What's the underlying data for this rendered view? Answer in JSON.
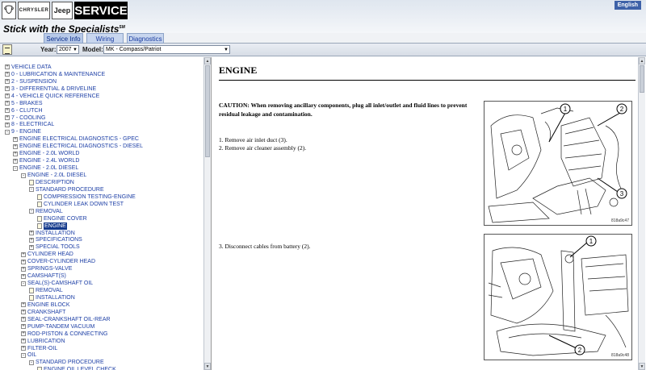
{
  "header": {
    "logo_ram": "RAM",
    "logo_chrysler": "CHRYSLER",
    "logo_jeep": "Jeep",
    "service": "SERVICE",
    "language": "English",
    "tagline": "Stick with the Specialists",
    "tagline_mark": "SM"
  },
  "tabs": [
    {
      "label": "Service Info"
    },
    {
      "label": "Wiring"
    },
    {
      "label": "Diagnostics"
    }
  ],
  "selectors": {
    "year_label": "Year:",
    "year_value": "2007",
    "model_label": "Model:",
    "model_value": "MK - Compass/Patriot"
  },
  "tree": [
    {
      "label": "VEHICLE DATA",
      "indent": 0,
      "kind": "exp",
      "sym": "+"
    },
    {
      "label": "0 - LUBRICATION & MAINTENANCE",
      "indent": 0,
      "kind": "exp",
      "sym": "+"
    },
    {
      "label": "2 - SUSPENSION",
      "indent": 0,
      "kind": "exp",
      "sym": "+"
    },
    {
      "label": "3 - DIFFERENTIAL & DRIVELINE",
      "indent": 0,
      "kind": "exp",
      "sym": "+"
    },
    {
      "label": "4 - VEHICLE QUICK REFERENCE",
      "indent": 0,
      "kind": "exp",
      "sym": "+"
    },
    {
      "label": "5 - BRAKES",
      "indent": 0,
      "kind": "exp",
      "sym": "+"
    },
    {
      "label": "6 - CLUTCH",
      "indent": 0,
      "kind": "exp",
      "sym": "+"
    },
    {
      "label": "7 - COOLING",
      "indent": 0,
      "kind": "exp",
      "sym": "+"
    },
    {
      "label": "8 - ELECTRICAL",
      "indent": 0,
      "kind": "exp",
      "sym": "+"
    },
    {
      "label": "9 - ENGINE",
      "indent": 0,
      "kind": "exp",
      "sym": "-"
    },
    {
      "label": "ENGINE ELECTRICAL DIAGNOSTICS - GPEC",
      "indent": 1,
      "kind": "exp",
      "sym": "+"
    },
    {
      "label": "ENGINE ELECTRICAL DIAGNOSTICS - DIESEL",
      "indent": 1,
      "kind": "exp",
      "sym": "+"
    },
    {
      "label": "ENGINE - 2.0L WORLD",
      "indent": 1,
      "kind": "exp",
      "sym": "+"
    },
    {
      "label": "ENGINE - 2.4L WORLD",
      "indent": 1,
      "kind": "exp",
      "sym": "+"
    },
    {
      "label": "ENGINE - 2.0L DIESEL",
      "indent": 1,
      "kind": "exp",
      "sym": "-"
    },
    {
      "label": "ENGINE - 2.0L DIESEL",
      "indent": 2,
      "kind": "exp",
      "sym": "-"
    },
    {
      "label": "DESCRIPTION",
      "indent": 3,
      "kind": "doc"
    },
    {
      "label": "STANDARD PROCEDURE",
      "indent": 3,
      "kind": "exp",
      "sym": "-"
    },
    {
      "label": "COMPRESSION TESTING-ENGINE",
      "indent": 4,
      "kind": "doc"
    },
    {
      "label": "CYLINDER LEAK DOWN TEST",
      "indent": 4,
      "kind": "doc"
    },
    {
      "label": "REMOVAL",
      "indent": 3,
      "kind": "exp",
      "sym": "-"
    },
    {
      "label": "ENGINE COVER",
      "indent": 4,
      "kind": "doc"
    },
    {
      "label": "ENGINE",
      "indent": 4,
      "kind": "doc",
      "selected": true
    },
    {
      "label": "INSTALLATION",
      "indent": 3,
      "kind": "exp",
      "sym": "+"
    },
    {
      "label": "SPECIFICATIONS",
      "indent": 3,
      "kind": "exp",
      "sym": "+"
    },
    {
      "label": "SPECIAL TOOLS",
      "indent": 3,
      "kind": "exp",
      "sym": "+"
    },
    {
      "label": "CYLINDER HEAD",
      "indent": 2,
      "kind": "exp",
      "sym": "+"
    },
    {
      "label": "COVER-CYLINDER HEAD",
      "indent": 2,
      "kind": "exp",
      "sym": "+"
    },
    {
      "label": "SPRINGS-VALVE",
      "indent": 2,
      "kind": "exp",
      "sym": "+"
    },
    {
      "label": "CAMSHAFT(S)",
      "indent": 2,
      "kind": "exp",
      "sym": "+"
    },
    {
      "label": "SEAL(S)-CAMSHAFT OIL",
      "indent": 2,
      "kind": "exp",
      "sym": "-"
    },
    {
      "label": "REMOVAL",
      "indent": 3,
      "kind": "doc"
    },
    {
      "label": "INSTALLATION",
      "indent": 3,
      "kind": "doc"
    },
    {
      "label": "ENGINE BLOCK",
      "indent": 2,
      "kind": "exp",
      "sym": "+"
    },
    {
      "label": "CRANKSHAFT",
      "indent": 2,
      "kind": "exp",
      "sym": "+"
    },
    {
      "label": "SEAL-CRANKSHAFT OIL-REAR",
      "indent": 2,
      "kind": "exp",
      "sym": "+"
    },
    {
      "label": "PUMP-TANDEM VACUUM",
      "indent": 2,
      "kind": "exp",
      "sym": "+"
    },
    {
      "label": "ROD-PISTON & CONNECTING",
      "indent": 2,
      "kind": "exp",
      "sym": "+"
    },
    {
      "label": "LUBRICATION",
      "indent": 2,
      "kind": "exp",
      "sym": "+"
    },
    {
      "label": "FILTER-OIL",
      "indent": 2,
      "kind": "exp",
      "sym": "+"
    },
    {
      "label": "OIL",
      "indent": 2,
      "kind": "exp",
      "sym": "-"
    },
    {
      "label": "STANDARD PROCEDURE",
      "indent": 3,
      "kind": "exp",
      "sym": "-"
    },
    {
      "label": "ENGINE OIL LEVEL CHECK",
      "indent": 4,
      "kind": "doc"
    }
  ],
  "content": {
    "title": "ENGINE",
    "caution": "CAUTION: When removing ancillary components, plug all inlet/outlet and fluid lines to prevent residual leakage and contamination.",
    "steps": [
      "1. Remove air inlet duct (3).",
      "2. Remove air cleaner assembly (2).",
      "3. Disconnect cables from battery (2)."
    ],
    "figure1": {
      "callouts": [
        "1",
        "2",
        "3"
      ],
      "code": "818a9c47"
    },
    "figure2": {
      "callouts": [
        "1",
        "2"
      ],
      "code": "818a9c48"
    }
  }
}
